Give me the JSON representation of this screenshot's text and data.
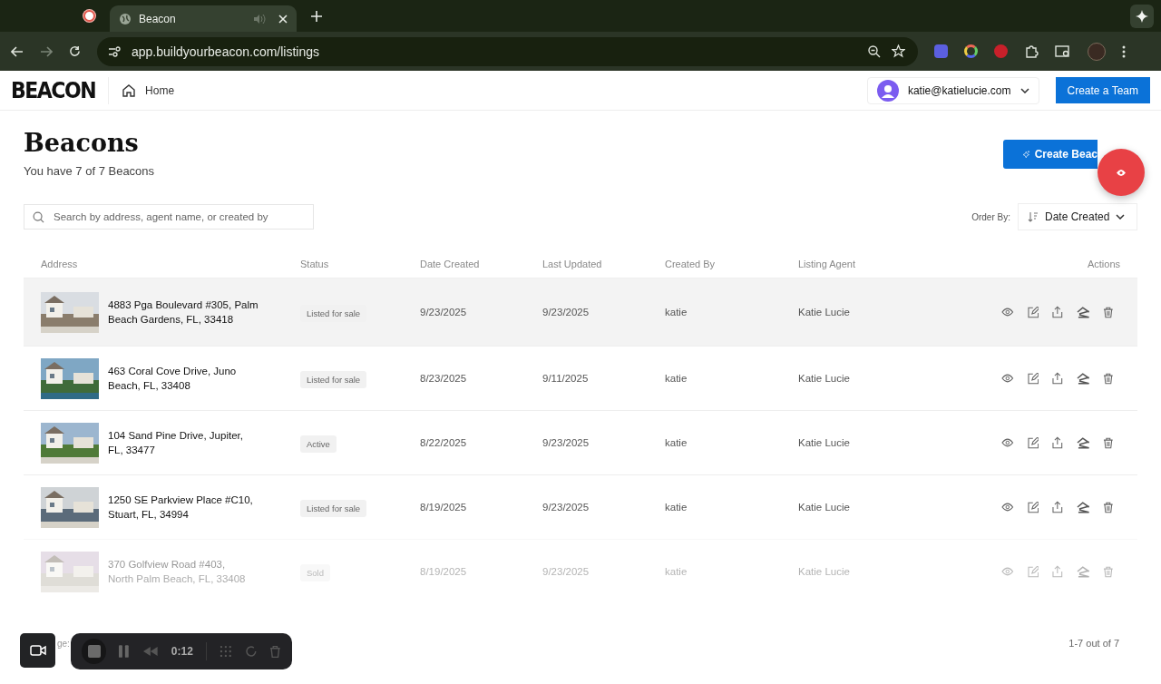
{
  "browser": {
    "tab": {
      "title": "Beacon"
    },
    "url": "app.buildyourbeacon.com/listings"
  },
  "header": {
    "logo": "BEACON",
    "home": "Home",
    "account": "katie@katielucie.com",
    "create_team": "Create a Team"
  },
  "page": {
    "title": "Beacons",
    "subtitle": "You have 7 of 7 Beacons",
    "create_button": "Create Beac",
    "search": {
      "placeholder": "Search by address, agent name, or created by"
    },
    "order_by": {
      "label": "Order By:",
      "value": "Date Created"
    }
  },
  "table": {
    "columns": [
      "Address",
      "Status",
      "Date Created",
      "Last Updated",
      "Created By",
      "Listing Agent",
      "Actions"
    ],
    "rows": [
      {
        "address_line1": "4883 Pga Boulevard #305, Palm Beach Gardens, FL, 33418",
        "address_line2": "",
        "status": "Listed for sale",
        "date_created": "9/23/2025",
        "last_updated": "9/23/2025",
        "created_by": "katie",
        "agent": "Katie Lucie",
        "highlighted": true,
        "faded": false
      },
      {
        "address_line1": "463 Coral Cove Drive, Juno Beach, FL, 33408",
        "address_line2": "",
        "status": "Listed for sale",
        "date_created": "8/23/2025",
        "last_updated": "9/11/2025",
        "created_by": "katie",
        "agent": "Katie Lucie",
        "highlighted": false,
        "faded": false
      },
      {
        "address_line1": "104 Sand Pine Drive, Jupiter, FL, 33477",
        "address_line2": "",
        "status": "Active",
        "date_created": "8/22/2025",
        "last_updated": "9/23/2025",
        "created_by": "katie",
        "agent": "Katie Lucie",
        "highlighted": false,
        "faded": false
      },
      {
        "address_line1": "1250 SE Parkview Place #C10, Stuart, FL, 34994",
        "address_line2": "",
        "status": "Listed for sale",
        "date_created": "8/19/2025",
        "last_updated": "9/23/2025",
        "created_by": "katie",
        "agent": "Katie Lucie",
        "highlighted": false,
        "faded": false
      },
      {
        "address_line1": "370 Golfview Road #403,",
        "address_line2": "North Palm Beach, FL, 33408",
        "status": "Sold",
        "date_created": "8/19/2025",
        "last_updated": "9/23/2025",
        "created_by": "katie",
        "agent": "Katie Lucie",
        "highlighted": false,
        "faded": true
      }
    ]
  },
  "pagination": {
    "label": "ge:",
    "range": "1-7 out of 7"
  },
  "recorder": {
    "time": "0:12"
  }
}
